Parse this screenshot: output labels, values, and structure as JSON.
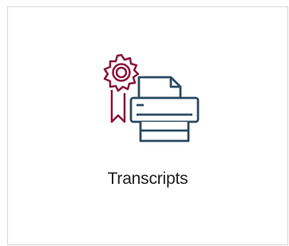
{
  "tile": {
    "label": "Transcripts",
    "icon": "transcript-printer-award-icon"
  },
  "colors": {
    "award": "#8a1538",
    "printer": "#2b4a63",
    "border": "#d7d7d7",
    "text": "#222222"
  }
}
